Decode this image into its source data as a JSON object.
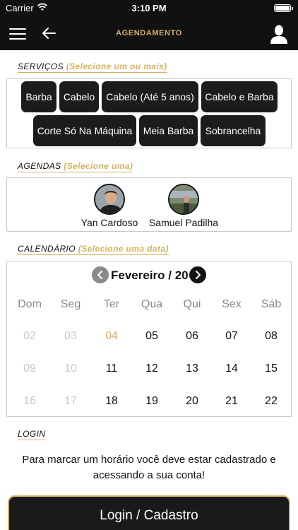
{
  "status_bar": {
    "carrier": "Carrier",
    "time": "3:10 PM"
  },
  "header": {
    "title": "AGENDAMENTO",
    "menu_icon": "hamburger-menu-icon",
    "back_icon": "arrow-left-icon",
    "user_icon": "user-profile-icon"
  },
  "colors": {
    "accent": "#d4b15e",
    "dark": "#111111",
    "chip": "#1c1c1c"
  },
  "services": {
    "label": "SERVIÇOS",
    "hint": "(Selecione um ou mais)",
    "items": [
      "Barba",
      "Cabelo",
      "Cabelo (Até 5 anos)",
      "Cabelo e Barba",
      "Corte Só Na Máquina",
      "Meia Barba",
      "Sobrancelha"
    ]
  },
  "agendas": {
    "label": "AGENDAS",
    "hint": "(Selecione uma)",
    "items": [
      {
        "name": "Yan Cardoso"
      },
      {
        "name": "Samuel Padilha"
      }
    ]
  },
  "calendar": {
    "label": "CALENDÁRIO",
    "hint": "(Selecione uma data)",
    "month": "Fevereiro / 20",
    "weekdays": [
      "Dom",
      "Seg",
      "Ter",
      "Qua",
      "Qui",
      "Sex",
      "Sáb"
    ],
    "weeks": [
      [
        "02",
        "03",
        "04",
        "05",
        "06",
        "07",
        "08"
      ],
      [
        "09",
        "10",
        "11",
        "12",
        "13",
        "14",
        "15"
      ],
      [
        "16",
        "17",
        "18",
        "19",
        "20",
        "21",
        "22"
      ]
    ],
    "disabled_days": [
      "02",
      "03",
      "09",
      "10",
      "16",
      "17"
    ],
    "today": "04"
  },
  "login": {
    "label": "LOGIN",
    "message": "Para marcar um horário você deve estar cadastrado e acessando a sua conta!",
    "button": "Login / Cadastro"
  }
}
